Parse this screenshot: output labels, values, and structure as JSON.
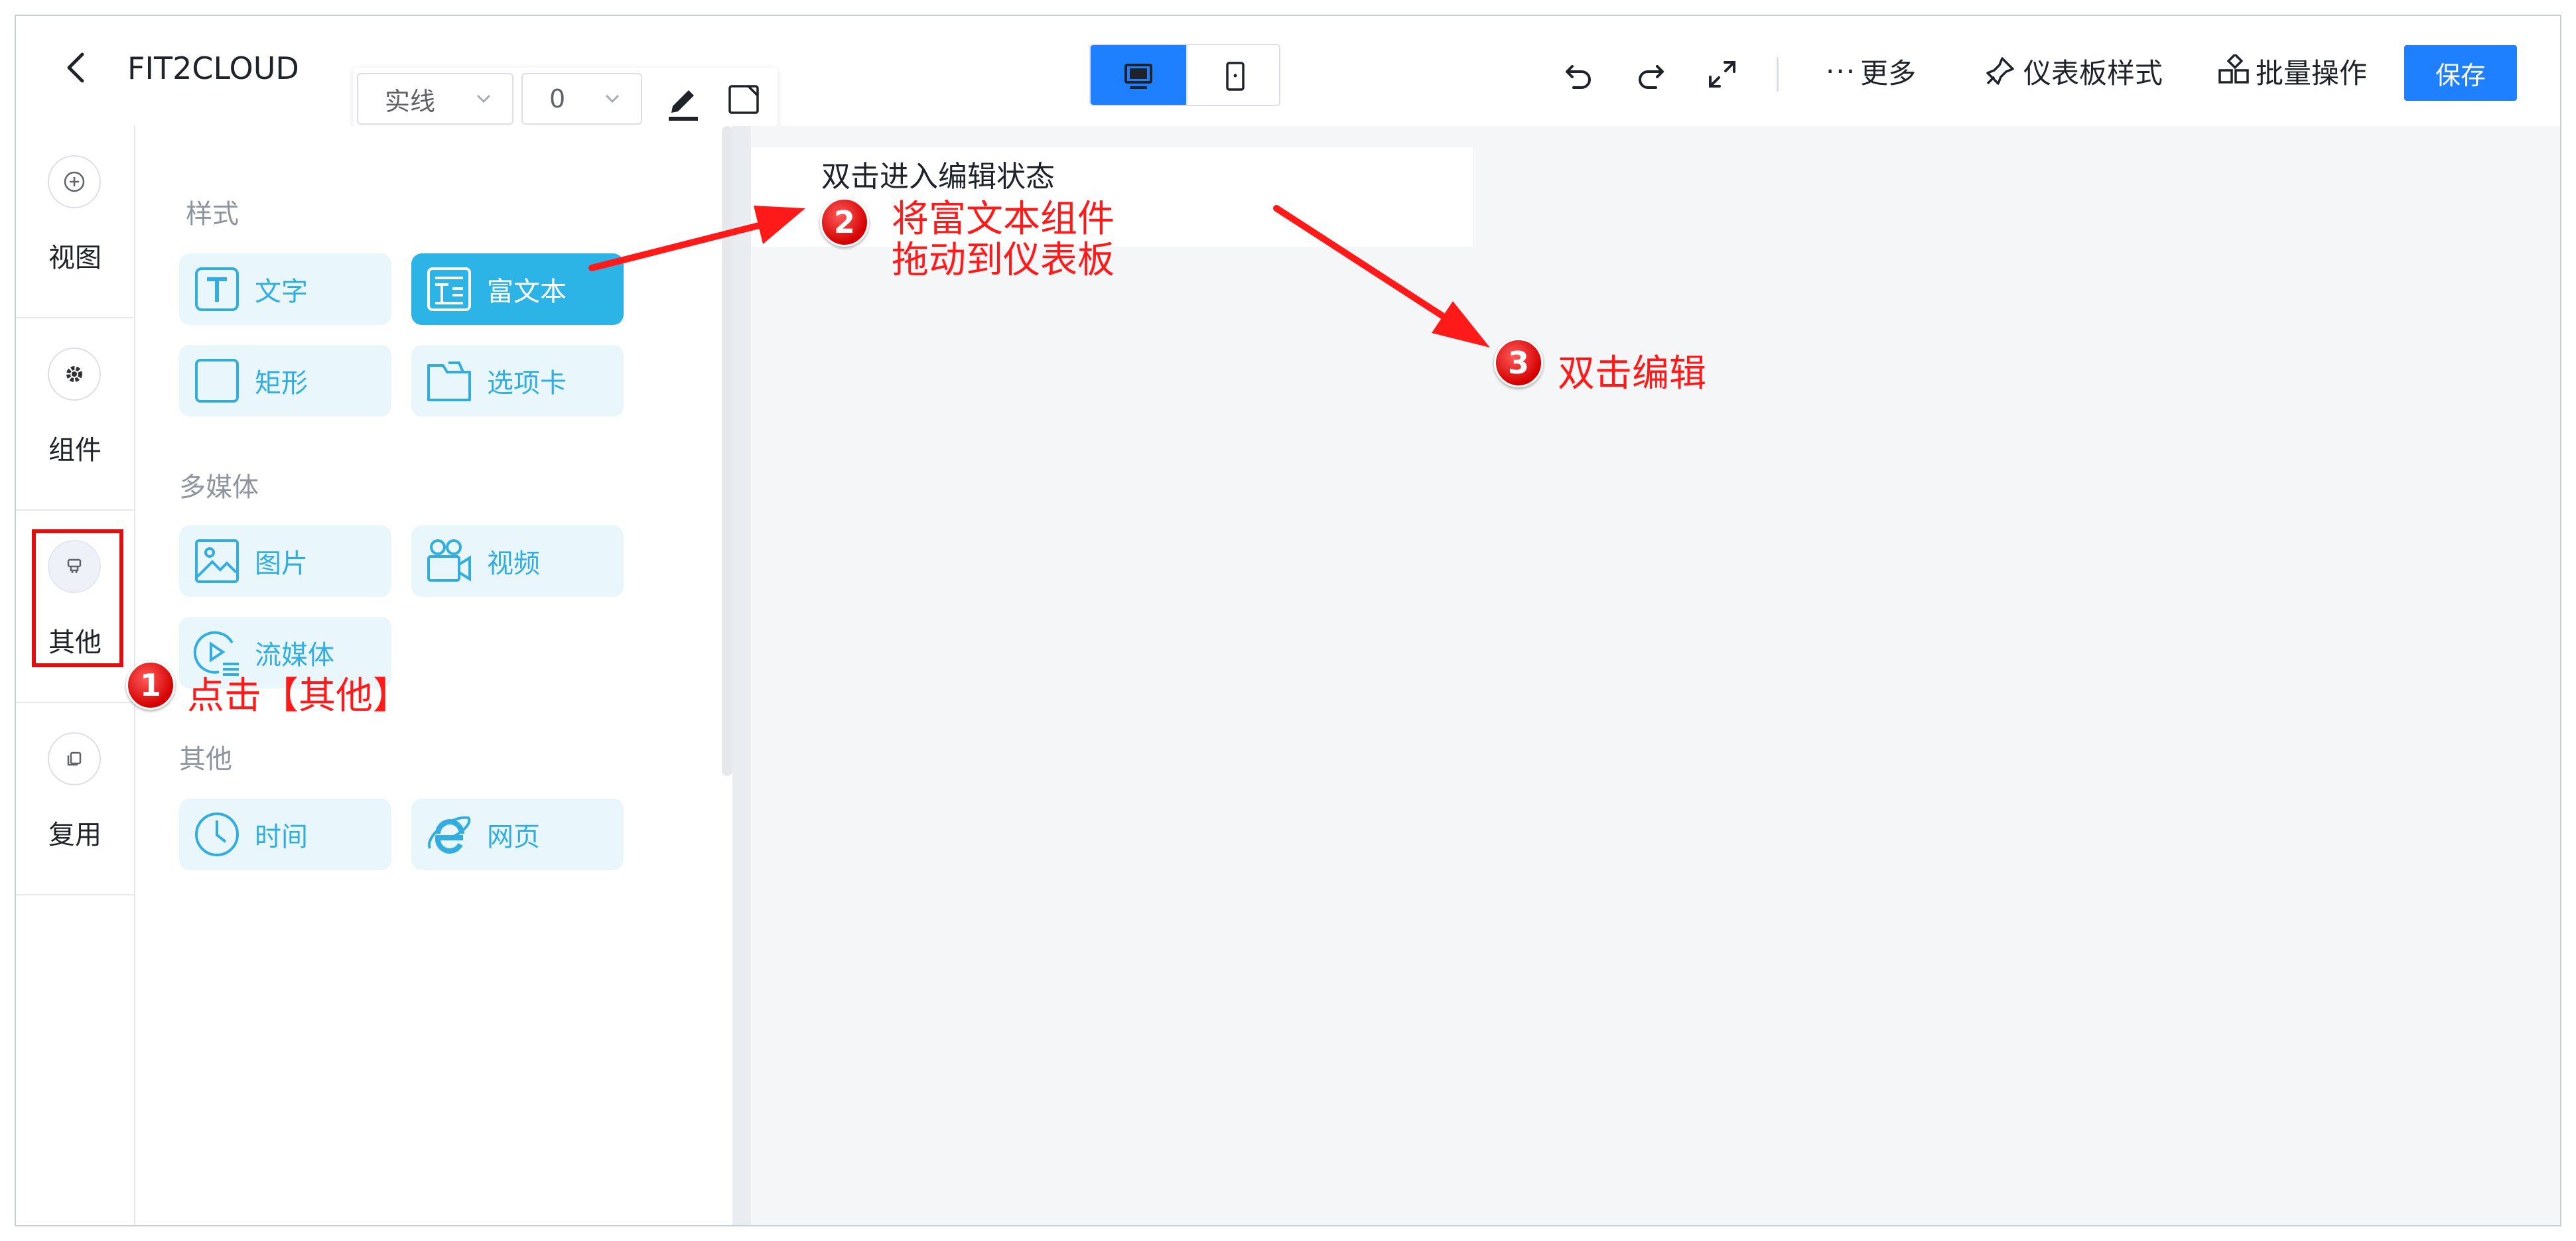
{
  "header": {
    "title": "FIT2CLOUD",
    "line_style": "实线",
    "line_width": "0",
    "more_label": "更多",
    "dashboard_style_label": "仪表板样式",
    "batch_label": "批量操作",
    "save_label": "保存"
  },
  "leftnav": {
    "items": [
      {
        "label": "视图",
        "icon": "plus-circle-icon"
      },
      {
        "label": "组件",
        "icon": "gear-icon"
      },
      {
        "label": "其他",
        "icon": "stamp-icon"
      },
      {
        "label": "复用",
        "icon": "copy-icon"
      }
    ]
  },
  "panel": {
    "sections": [
      {
        "title": "样式",
        "items": [
          "文字",
          "富文本",
          "矩形",
          "选项卡"
        ]
      },
      {
        "title": "多媒体",
        "items": [
          "图片",
          "视频",
          "流媒体"
        ]
      },
      {
        "title": "其他",
        "items": [
          "时间",
          "网页"
        ]
      }
    ]
  },
  "canvas": {
    "rich_text_placeholder": "双击进入编辑状态"
  },
  "annotations": {
    "step1_number": "1",
    "step1_text": "点击【其他】",
    "step2_number": "2",
    "step2_line1": "将富文本组件",
    "step2_line2": "拖动到仪表板",
    "step3_number": "3",
    "step3_text": "双击编辑"
  },
  "colors": {
    "primary": "#1e80ff",
    "tile_bg": "#e9f6fb",
    "tile_active": "#2cb4e6",
    "annotation_red": "#ff1a1a"
  }
}
